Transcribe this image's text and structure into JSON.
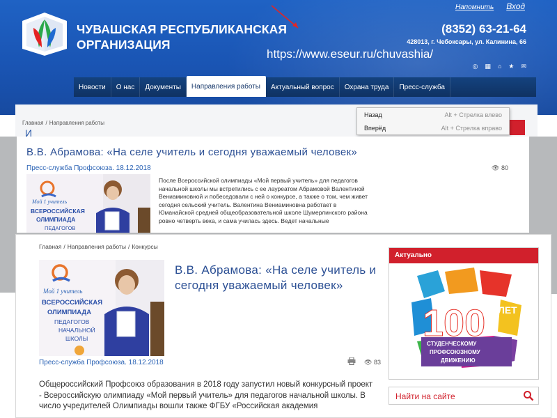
{
  "colors": {
    "header_blue": "#1a55b4",
    "nav_dark": "#0f3263",
    "accent_red": "#d1202c",
    "link_blue": "#2b4f94"
  },
  "header": {
    "org_name_line1": "ЧУВАШСКАЯ РЕСПУБЛИКАНСКАЯ",
    "org_name_line2": "ОРГАНИЗАЦИЯ",
    "remind_label": "Напомнить",
    "login_label": "Вход",
    "phone": "(8352) 63-21-64",
    "address": "428013, г. Чебоксары, ул. Калинина, 66",
    "url": "https://www.eseur.ru/chuvashia/",
    "icons": [
      "rss-icon",
      "sitemap-icon",
      "home-icon",
      "star-icon",
      "mail-icon"
    ]
  },
  "nav": {
    "items": [
      {
        "label": "Новости"
      },
      {
        "label": "О нас"
      },
      {
        "label": "Документы"
      },
      {
        "label": "Направления работы"
      },
      {
        "label": "Актуальный вопрос"
      },
      {
        "label": "Охрана труда"
      },
      {
        "label": "Пресс-служба"
      }
    ],
    "active_index": 3
  },
  "back_page": {
    "breadcrumb": [
      "Главная",
      "Направления работы"
    ],
    "title_fragment": "И"
  },
  "context_menu": {
    "items": [
      {
        "label": "Назад",
        "shortcut": "Alt + Стрелка влево"
      },
      {
        "label": "Вперёд",
        "shortcut": "Alt + Стрелка вправо"
      }
    ]
  },
  "card1": {
    "title": "В.В. Абрамова: «На селе учитель и сегодня уважаемый человек»",
    "meta": "Пресс-служба Профсоюза. 18.12.2018",
    "views": "80",
    "text": "После Всероссийской олимпиады «Мой первый учитель» для педагогов начальной школы мы встретились с ее лауреатом Абрамовой Валентиной Вениаминовной и побеседовали с ней о конкурсе, а также о том, чем живет сегодня сельский учитель. Валентина Вениаминовна работает в Юманайской средней общеобразовательной школе Шумерлинского района ровно четверть века, и сама училась здесь. Ведет начальные"
  },
  "card2": {
    "breadcrumb": [
      "Главная",
      "Направления работы",
      "Конкурсы"
    ],
    "title": "В.В. Абрамова: «На селе учитель и сегодня уважаемый человек»",
    "meta": "Пресс-служба Профсоюза. 18.12.2018",
    "views": "83",
    "body": "Общероссийский Профсоюз образования в 2018 году запустил новый конкурсный проект - Всероссийскую олимпиаду «Мой первый учитель» для педагогов начальной школы. В число учредителей Олимпиады вошли также ФГБУ «Российская академия"
  },
  "photo_banner": {
    "line1": "Мой 1 учитель",
    "line2": "ВСЕРОССИЙСКАЯ",
    "line3": "ОЛИМПИАДА",
    "line4": "ПЕДАГОГОВ",
    "line5": "НАЧАЛЬНОЙ",
    "line6": "ШКОЛЫ"
  },
  "sidebar": {
    "actual_heading": "Актуально",
    "banner": {
      "number": "100",
      "suffix": "ЛЕТ",
      "line1": "СТУДЕНЧЕСКОМУ",
      "line2": "ПРОФСОЮЗНОМУ",
      "line3": "ДВИЖЕНИЮ"
    },
    "search_label": "Найти на сайте"
  }
}
